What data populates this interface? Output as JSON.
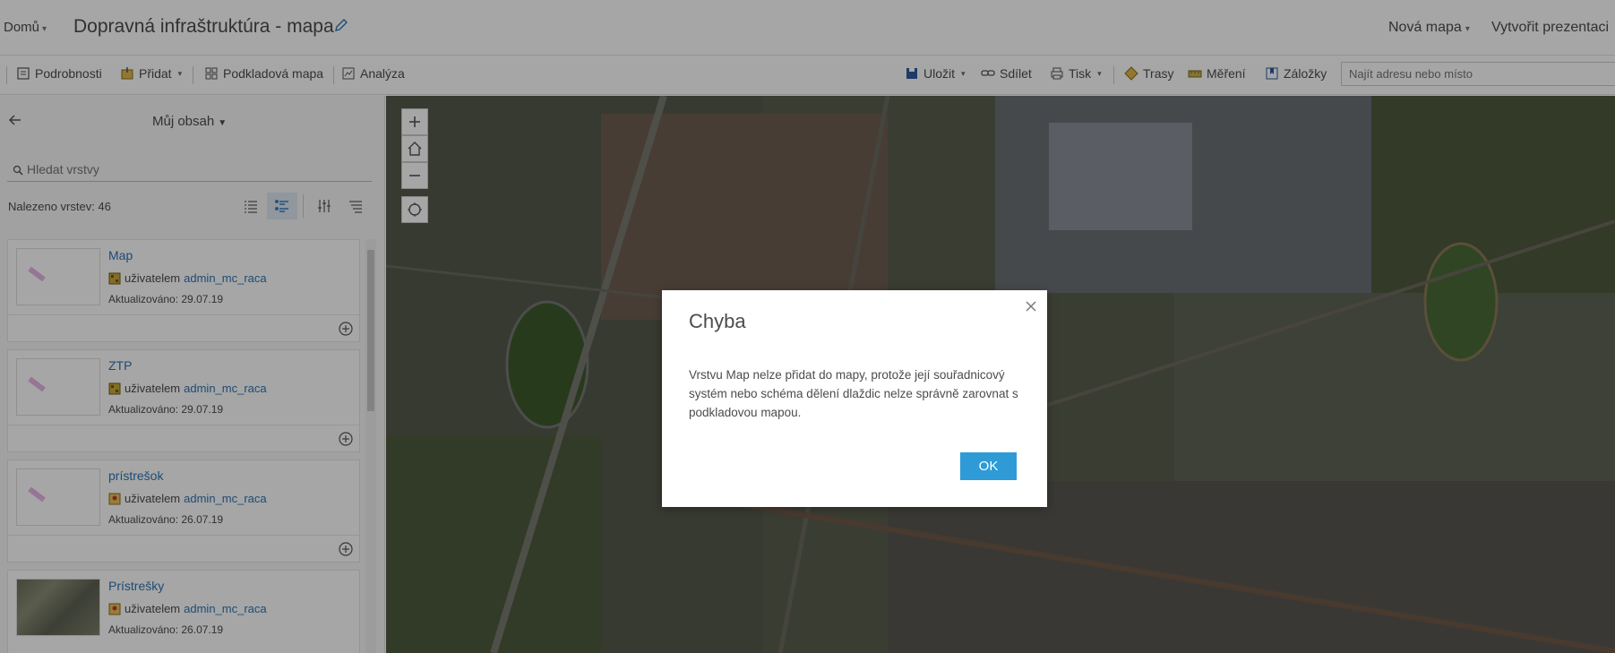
{
  "header": {
    "home": "Domů",
    "title": "Dopravná infraštruktúra - mapa",
    "new_map": "Nová mapa",
    "create_presentation": "Vytvořit prezentaci"
  },
  "toolbar": {
    "details": "Podrobnosti",
    "add": "Přidat",
    "basemap": "Podkladová mapa",
    "analysis": "Analýza",
    "save": "Uložit",
    "share": "Sdílet",
    "print": "Tisk",
    "directions": "Trasy",
    "measure": "Měření",
    "bookmarks": "Záložky",
    "search_placeholder": "Najít adresu nebo místo"
  },
  "sidebar": {
    "content_title": "Můj obsah",
    "search_placeholder": "Hledat vrstvy",
    "found_count": "Nalezeno vrstev: 46",
    "cards": [
      {
        "title": "Map",
        "owner_prefix": "uživatelem",
        "owner": "admin_mc_raca",
        "updated": "Aktualizováno: 29.07.19"
      },
      {
        "title": "ZTP",
        "owner_prefix": "uživatelem",
        "owner": "admin_mc_raca",
        "updated": "Aktualizováno: 29.07.19"
      },
      {
        "title": "prístrešok",
        "owner_prefix": "uživatelem",
        "owner": "admin_mc_raca",
        "updated": "Aktualizováno: 26.07.19"
      },
      {
        "title": "Prístrešky",
        "owner_prefix": "uživatelem",
        "owner": "admin_mc_raca",
        "updated": "Aktualizováno: 26.07.19"
      }
    ]
  },
  "dialog": {
    "title": "Chyba",
    "message": "Vrstvu Map nelze přidat do mapy, protože její souřadnicový systém nebo schéma dělení dlaždic nelze správně zarovnat s podkladovou mapou.",
    "ok": "OK"
  },
  "colors": {
    "accent": "#2e9bd6",
    "link": "#2e74b5"
  }
}
